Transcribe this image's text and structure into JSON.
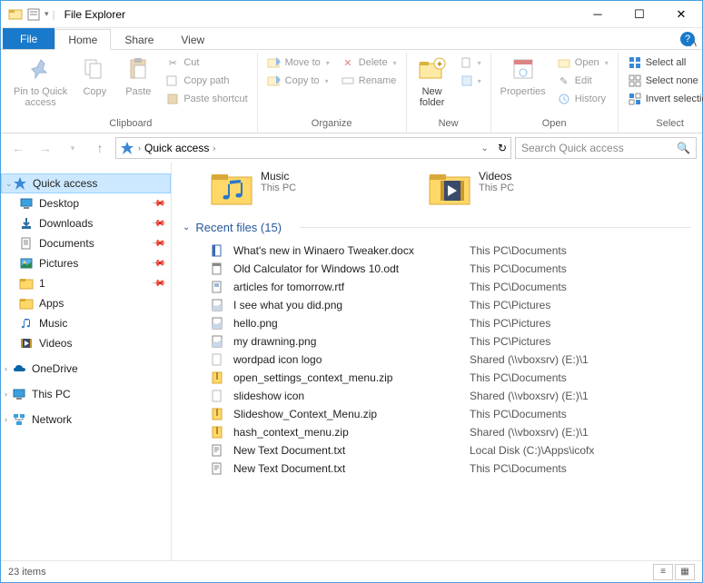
{
  "window": {
    "title": "File Explorer"
  },
  "tabs": {
    "file": "File",
    "home": "Home",
    "share": "Share",
    "view": "View"
  },
  "ribbon": {
    "clipboard": {
      "label": "Clipboard",
      "pin": "Pin to Quick\naccess",
      "copy": "Copy",
      "paste": "Paste",
      "cut": "Cut",
      "copypath": "Copy path",
      "pasteshort": "Paste shortcut"
    },
    "organize": {
      "label": "Organize",
      "moveto": "Move to",
      "copyto": "Copy to",
      "delete": "Delete",
      "rename": "Rename"
    },
    "new": {
      "label": "New",
      "newfolder": "New\nfolder"
    },
    "open": {
      "label": "Open",
      "properties": "Properties",
      "open": "Open",
      "edit": "Edit",
      "history": "History"
    },
    "select": {
      "label": "Select",
      "all": "Select all",
      "none": "Select none",
      "invert": "Invert selection"
    }
  },
  "address": {
    "location": "Quick access",
    "search_placeholder": "Search Quick access"
  },
  "sidebar": {
    "quickaccess": "Quick access",
    "items": [
      {
        "label": "Desktop",
        "pinned": true
      },
      {
        "label": "Downloads",
        "pinned": true
      },
      {
        "label": "Documents",
        "pinned": true
      },
      {
        "label": "Pictures",
        "pinned": true
      },
      {
        "label": "1",
        "pinned": true
      },
      {
        "label": "Apps",
        "pinned": false
      },
      {
        "label": "Music",
        "pinned": false
      },
      {
        "label": "Videos",
        "pinned": false
      }
    ],
    "onedrive": "OneDrive",
    "thispc": "This PC",
    "network": "Network"
  },
  "folders": [
    {
      "name": "Music",
      "location": "This PC"
    },
    {
      "name": "Videos",
      "location": "This PC"
    }
  ],
  "recent": {
    "header": "Recent files (15)",
    "files": [
      {
        "name": "What's new in Winaero Tweaker.docx",
        "path": "This PC\\Documents",
        "type": "docx"
      },
      {
        "name": "Old Calculator for Windows 10.odt",
        "path": "This PC\\Documents",
        "type": "odt"
      },
      {
        "name": "articles for tomorrow.rtf",
        "path": "This PC\\Documents",
        "type": "rtf"
      },
      {
        "name": "I see what you did.png",
        "path": "This PC\\Pictures",
        "type": "png"
      },
      {
        "name": "hello.png",
        "path": "This PC\\Pictures",
        "type": "png"
      },
      {
        "name": "my drawning.png",
        "path": "This PC\\Pictures",
        "type": "png"
      },
      {
        "name": "wordpad icon logo",
        "path": "Shared (\\\\vboxsrv) (E:)\\1",
        "type": "file"
      },
      {
        "name": "open_settings_context_menu.zip",
        "path": "This PC\\Documents",
        "type": "zip"
      },
      {
        "name": "slideshow icon",
        "path": "Shared (\\\\vboxsrv) (E:)\\1",
        "type": "file"
      },
      {
        "name": "Slideshow_Context_Menu.zip",
        "path": "This PC\\Documents",
        "type": "zip"
      },
      {
        "name": "hash_context_menu.zip",
        "path": "Shared (\\\\vboxsrv) (E:)\\1",
        "type": "zip"
      },
      {
        "name": "New Text Document.txt",
        "path": "Local Disk (C:)\\Apps\\icofx",
        "type": "txt"
      },
      {
        "name": "New Text Document.txt",
        "path": "This PC\\Documents",
        "type": "txt"
      }
    ]
  },
  "status": {
    "items": "23 items"
  }
}
